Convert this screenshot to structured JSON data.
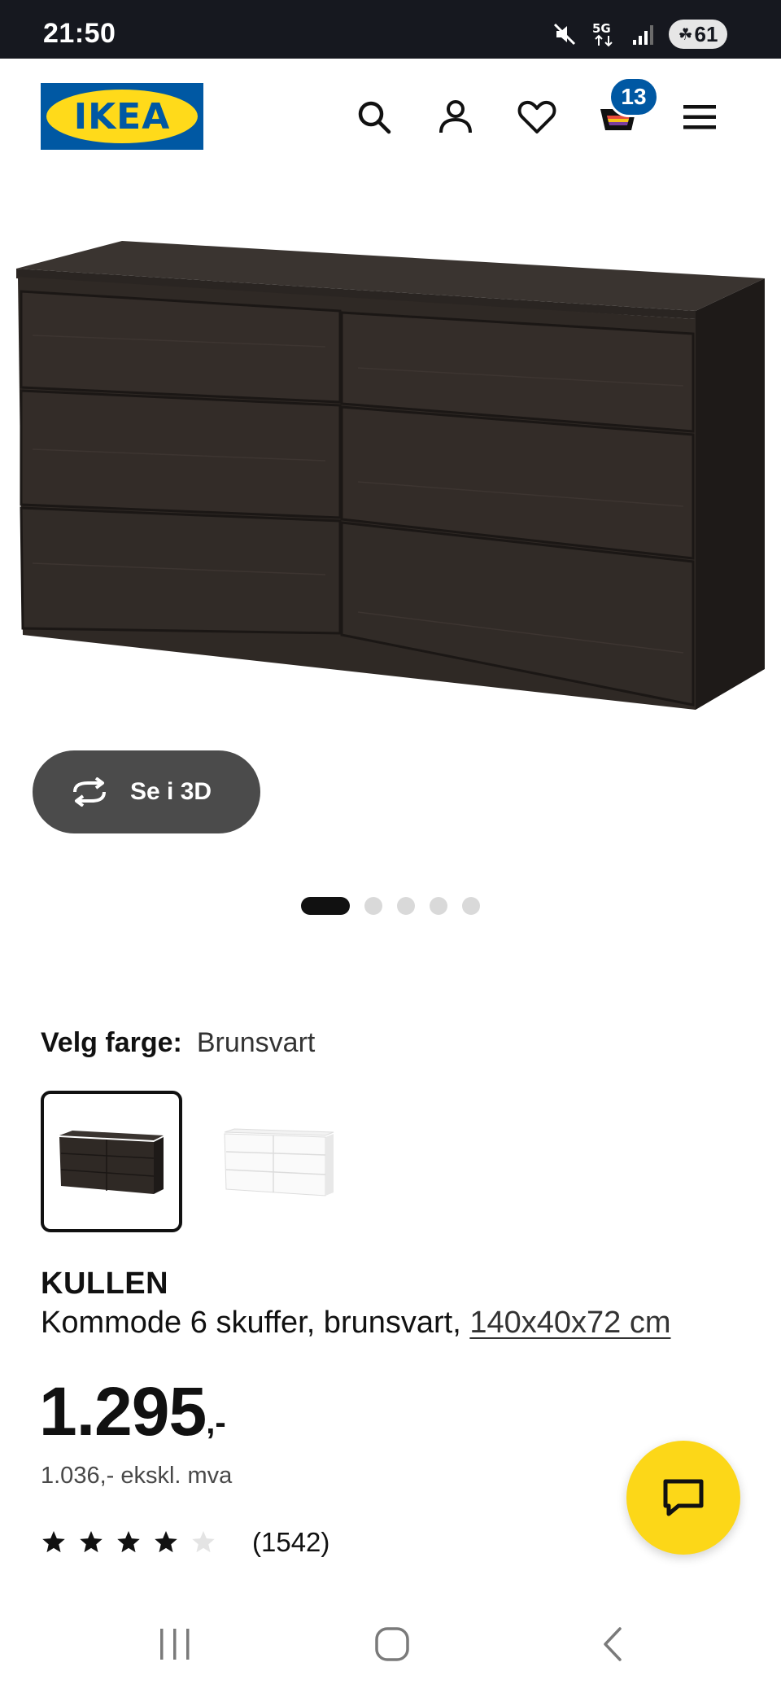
{
  "status_bar": {
    "time": "21:50",
    "network": "5G",
    "battery": "61",
    "icons": [
      "mute-icon",
      "5g-icon",
      "signal-icon",
      "battery-icon"
    ]
  },
  "header": {
    "logo_text": "IKEA",
    "cart_count": "13",
    "icons": [
      "search-icon",
      "account-icon",
      "heart-icon",
      "cart-icon",
      "menu-icon"
    ]
  },
  "gallery": {
    "view_3d_label": "Se i 3D",
    "slide_count": 5,
    "active_slide": 1
  },
  "color": {
    "label": "Velg farge:",
    "value": "Brunsvart",
    "options": [
      "Brunsvart",
      "Hvit"
    ]
  },
  "product": {
    "name": "KULLEN",
    "description": "Kommode 6 skuffer, brunsvart, ",
    "size": "140x40x72 cm",
    "price": "1.295",
    "price_suffix": ",-",
    "price_ex_vat": "1.036,- ekskl. mva",
    "rating": 4,
    "rating_max": 5,
    "review_count": "(1542)"
  },
  "colors": {
    "ikea_blue": "#0058a3",
    "ikea_yellow": "#ffda1a",
    "dresser_brown": "#2f2925",
    "chat_yellow": "#fcd718"
  }
}
